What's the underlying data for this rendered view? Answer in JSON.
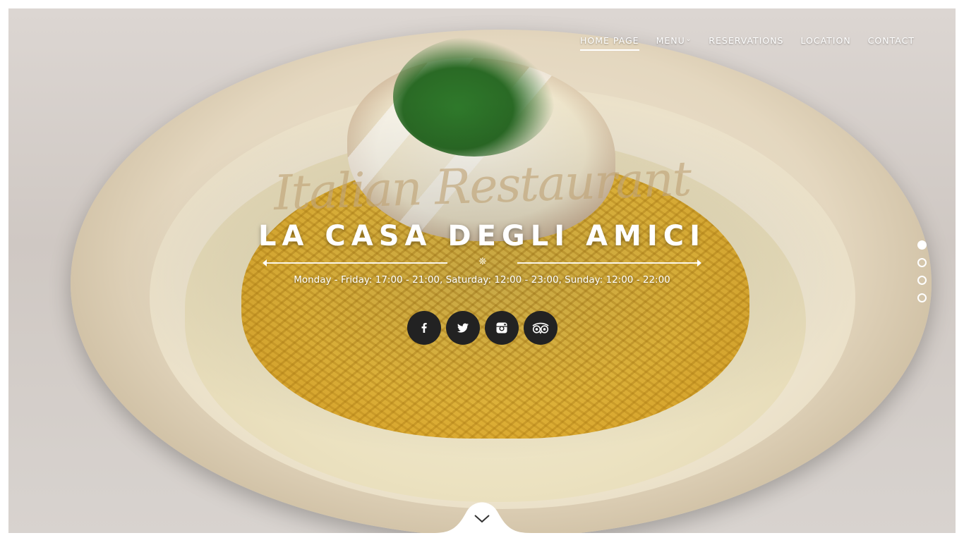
{
  "nav": {
    "items": [
      {
        "label": "HOME PAGE",
        "active": true
      },
      {
        "label": "MENU",
        "dropdown": true
      },
      {
        "label": "RESERVATIONS"
      },
      {
        "label": "LOCATION"
      },
      {
        "label": "CONTACT"
      }
    ]
  },
  "hero": {
    "script_title": "Italian Restaurant",
    "title": "LA CASA DEGLI AMICI",
    "hours": "Monday - Friday: 17:00 - 21:00, Saturday: 12:00 - 23:00, Sunday: 12:00 - 22:00",
    "divider_glyph": "❊"
  },
  "social": [
    {
      "name": "facebook",
      "icon": "facebook-icon"
    },
    {
      "name": "twitter",
      "icon": "twitter-icon"
    },
    {
      "name": "instagram",
      "icon": "instagram-icon"
    },
    {
      "name": "tripadvisor",
      "icon": "tripadvisor-icon"
    }
  ],
  "slider": {
    "count": 4,
    "active": 0
  },
  "colors": {
    "button_bg": "#222222",
    "text": "#ffffff"
  }
}
